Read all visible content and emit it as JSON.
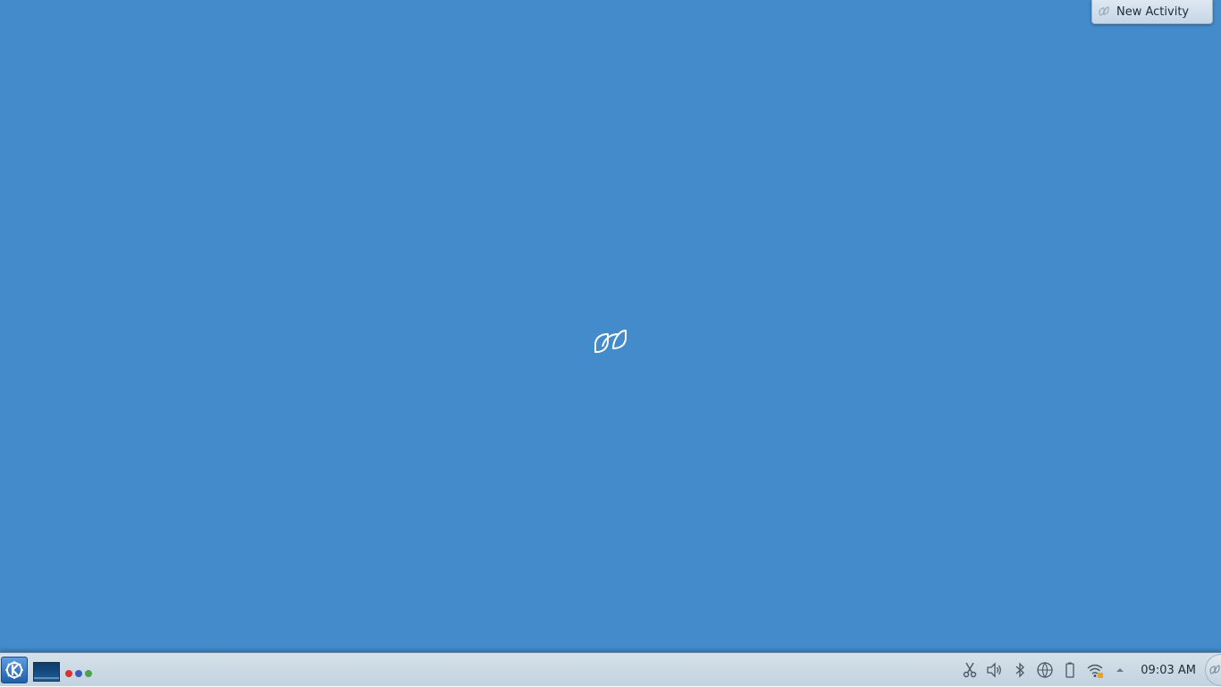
{
  "activity_popup": {
    "label": "New Activity",
    "icon": "new-activity-icon"
  },
  "desktop": {
    "center_icon": "plasma-activity-logo-icon",
    "background_color": "#438bca"
  },
  "panel": {
    "launcher_icon": "kde-kickoff-icon",
    "task_icon": "desktop-preview-icon",
    "pager_dots": [
      {
        "color": "#d93030"
      },
      {
        "color": "#3b5fb8"
      },
      {
        "color": "#4aa34a"
      }
    ],
    "tray_icons": [
      "klipper-scissors-icon",
      "volume-icon",
      "bluetooth-icon",
      "network-icon",
      "battery-icon",
      "wifi-icon",
      "expand-tray-arrow-icon"
    ],
    "clock": "09:03 AM",
    "cashew_icon": "panel-toolbox-icon"
  }
}
